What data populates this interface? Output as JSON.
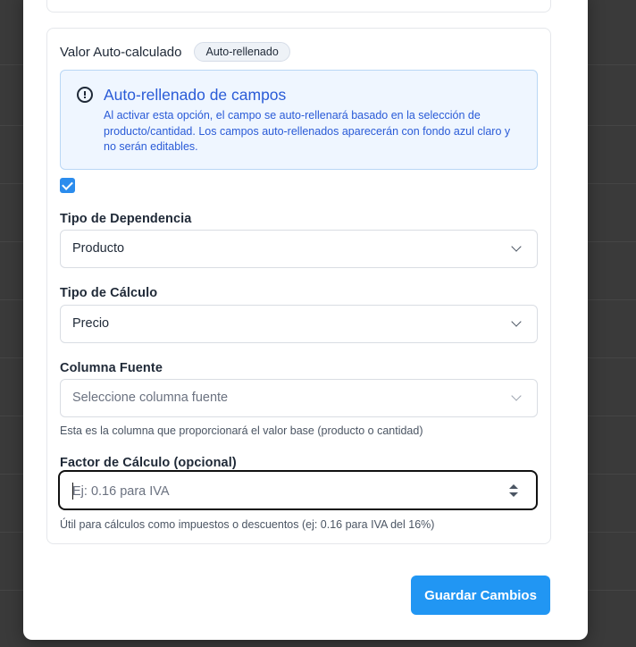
{
  "section": {
    "title": "Valor Auto-calculado",
    "badge": "Auto-rellenado"
  },
  "info": {
    "icon": "alert-circle-icon",
    "title": "Auto-rellenado de campos",
    "text": "Al activar esta opción, el campo se auto-rellenará basado en la selección de producto/cantidad. Los campos auto-rellenados aparecerán con fondo azul claro y no serán editables."
  },
  "auto_fill_checked": true,
  "dependency": {
    "label": "Tipo de Dependencia",
    "value": "Producto"
  },
  "calculation": {
    "label": "Tipo de Cálculo",
    "value": "Precio"
  },
  "source_column": {
    "label": "Columna Fuente",
    "placeholder": "Seleccione columna fuente",
    "help": "Esta es la columna que proporcionará el valor base (producto o cantidad)"
  },
  "factor": {
    "label": "Factor de Cálculo (opcional)",
    "placeholder": "Ej: 0.16 para IVA",
    "value": "",
    "help": "Útil para cálculos como impuestos o descuentos (ej: 0.16 para IVA del 16%)"
  },
  "actions": {
    "save_label": "Guardar Cambios"
  },
  "colors": {
    "accent": "#2196f3",
    "info_text": "#2a5bd7",
    "info_bg": "#eff6ff"
  }
}
